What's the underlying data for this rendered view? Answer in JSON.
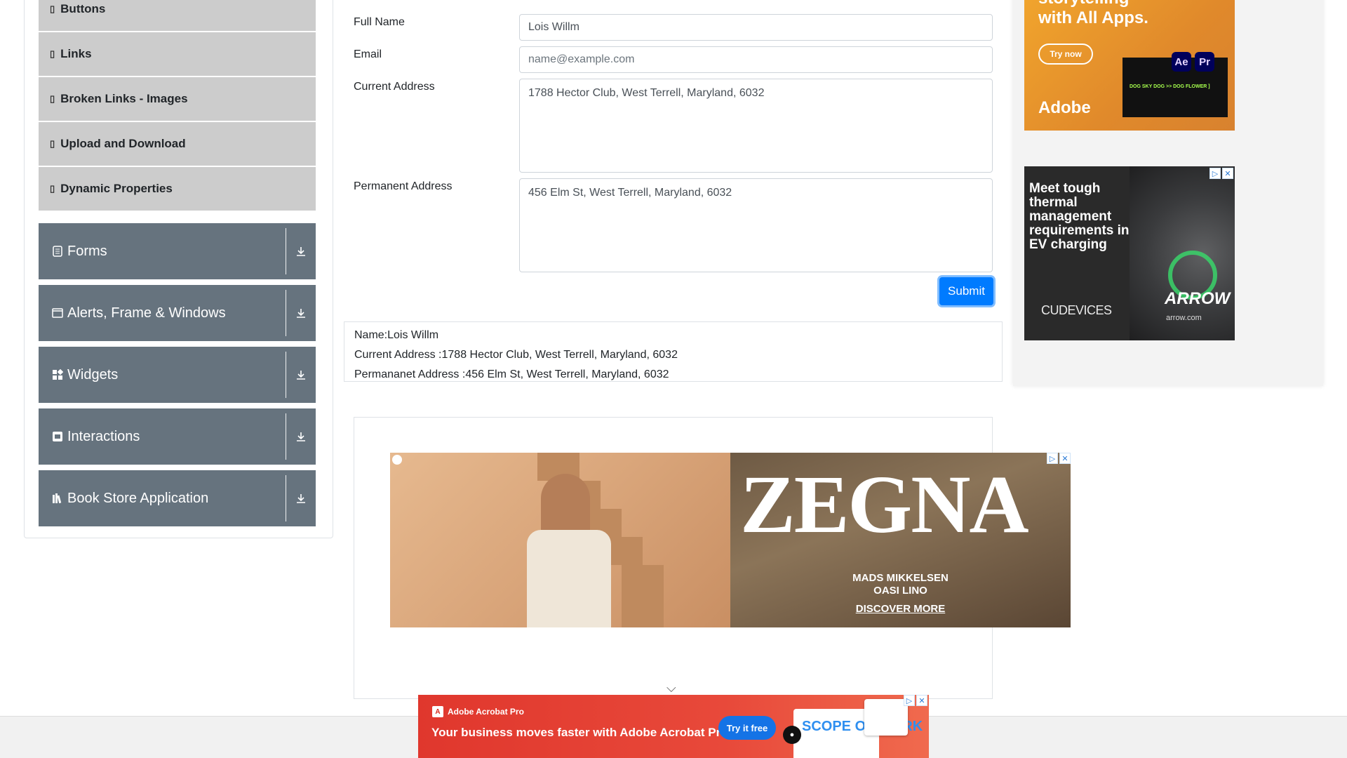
{
  "sidebar": {
    "sub_items": [
      {
        "label": "Buttons"
      },
      {
        "label": "Links"
      },
      {
        "label": "Broken Links - Images"
      },
      {
        "label": "Upload and Download"
      },
      {
        "label": "Dynamic Properties"
      }
    ],
    "groups": [
      {
        "label": "Forms",
        "icon": "form-icon"
      },
      {
        "label": "Alerts, Frame & Windows",
        "icon": "window-icon"
      },
      {
        "label": "Widgets",
        "icon": "widgets-icon"
      },
      {
        "label": "Interactions",
        "icon": "interactions-icon"
      },
      {
        "label": "Book Store Application",
        "icon": "books-icon"
      }
    ]
  },
  "form": {
    "full_name_label": "Full Name",
    "full_name_value": "Lois Willm",
    "email_label": "Email",
    "email_placeholder": "name@example.com",
    "current_address_label": "Current Address",
    "current_address_value": "1788 Hector Club, West Terrell, Maryland, 6032",
    "permanent_address_label": "Permanent Address",
    "permanent_address_value": "456 Elm St, West Terrell, Maryland, 6032",
    "submit_label": "Submit"
  },
  "output": {
    "name": "Name:Lois Willm",
    "current_address": "Current Address :1788 Hector Club, West Terrell, Maryland, 6032",
    "permanent_address": "Permananet Address :456 Elm St, West Terrell, Maryland, 6032"
  },
  "ads": {
    "zegna": {
      "logo": "ZEGNA",
      "line1": "MADS MIKKELSEN",
      "line2": "OASI LINO",
      "cta": "DISCOVER MORE"
    },
    "adobe": {
      "headline1": "storytelling",
      "headline2": "with All Apps.",
      "cta": "Try now",
      "brand": "Adobe",
      "app1": "Ae",
      "app2": "Pr",
      "screen_text": "DOG SKY DOG >> DOG FLOWER ]"
    },
    "arrow": {
      "headline": "Meet tough thermal management requirements in EV charging",
      "partner": "CUDEVICES",
      "brand": "ARROW",
      "url": "arrow.com"
    },
    "acrobat": {
      "product": "Adobe Acrobat Pro",
      "message": "Your business moves faster with Adobe Acrobat Pro.",
      "cta": "Try it free",
      "doc_title": "SCOPE OF WORK"
    }
  },
  "colors": {
    "sidebar_group_bg": "#66737e",
    "sidebar_sub_bg": "#cccccc",
    "primary": "#007bff"
  }
}
